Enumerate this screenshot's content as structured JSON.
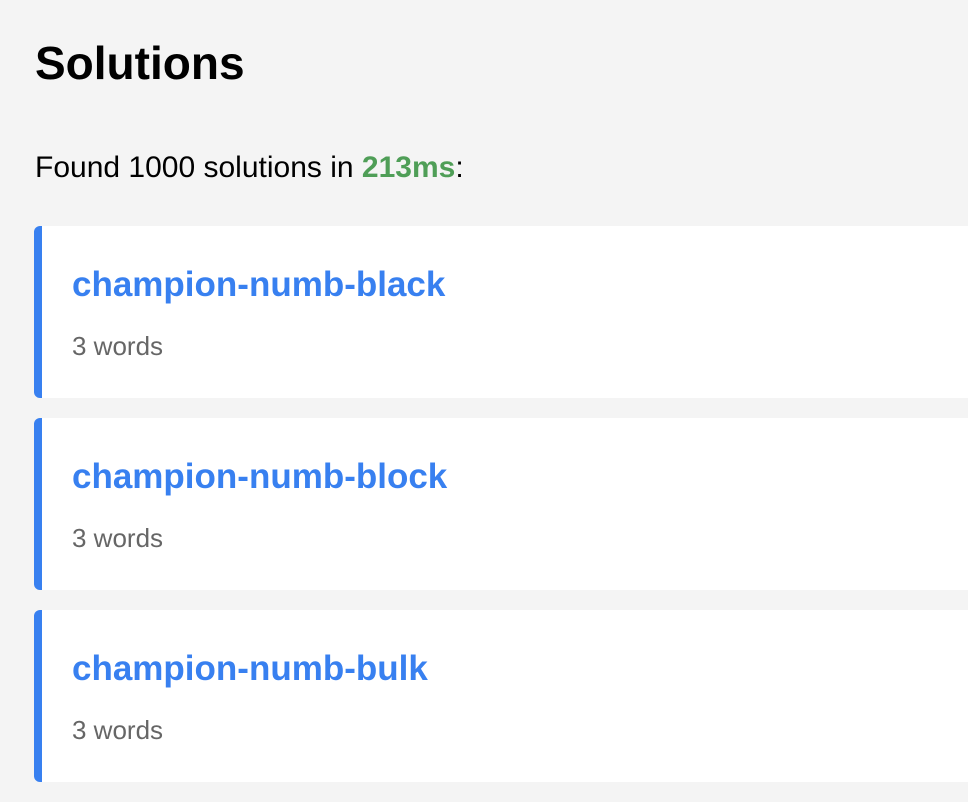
{
  "page": {
    "title": "Solutions"
  },
  "summary": {
    "prefix": "Found 1000 solutions in ",
    "time": "213ms",
    "suffix": ":"
  },
  "colors": {
    "background": "#f4f4f4",
    "accent": "#3880f0",
    "time_highlight": "#4f9e57",
    "meta_text": "#666666"
  },
  "results": [
    {
      "title": "champion-numb-black",
      "meta": "3 words"
    },
    {
      "title": "champion-numb-block",
      "meta": "3 words"
    },
    {
      "title": "champion-numb-bulk",
      "meta": "3 words"
    }
  ]
}
